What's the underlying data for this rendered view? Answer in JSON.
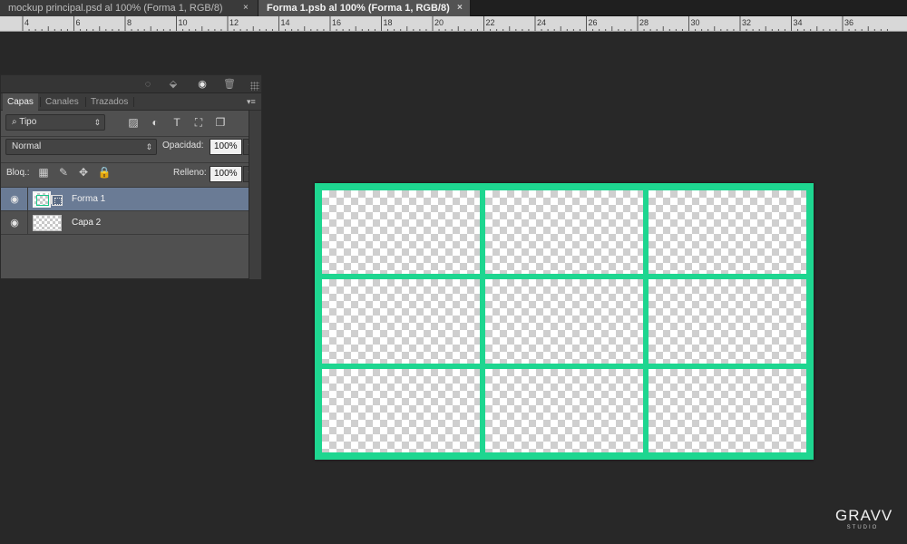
{
  "tabs": [
    {
      "title": "mockup principal.psd al 100% (Forma 1, RGB/8)",
      "close": "×",
      "active": false
    },
    {
      "title": "Forma 1.psb al 100% (Forma 1, RGB/8)",
      "close": "×",
      "active": true
    }
  ],
  "ruler": {
    "labels": [
      "4",
      "6",
      "8",
      "10",
      "12",
      "14",
      "16",
      "18",
      "20",
      "22",
      "24",
      "26",
      "28",
      "30",
      "32",
      "34",
      "36"
    ]
  },
  "panel": {
    "top_icons": [
      "marquee-icon",
      "fill-icon",
      "eye-icon",
      "trash-icon"
    ],
    "tabs": [
      "Capas",
      "Canales",
      "Trazados"
    ],
    "menu_glyph": "▾≡",
    "filter": {
      "label": "Tipo",
      "icon": "search-icon"
    },
    "filter_icons": [
      "image-filter-icon",
      "adjustment-filter-icon",
      "type-filter-icon",
      "shape-filter-icon",
      "smart-object-filter-icon"
    ],
    "blend_mode": "Normal",
    "opacity_label": "Opacidad:",
    "opacity_value": "100%",
    "lock_label": "Bloq.:",
    "lock_icons": [
      "lock-transparency-icon",
      "lock-brush-icon",
      "lock-move-icon",
      "lock-all-icon"
    ],
    "fill_label": "Relleno:",
    "fill_value": "100%",
    "layers": [
      {
        "name": "Forma 1",
        "selected": true,
        "visible": true,
        "kind": "shape"
      },
      {
        "name": "Capa 2",
        "selected": false,
        "visible": true,
        "kind": "pixel"
      }
    ]
  },
  "canvas": {
    "grid_rows": 3,
    "grid_cols": 3,
    "frame_color": "#1ed690"
  },
  "logo": {
    "main": "GRAVV",
    "sub": "STUDIO"
  }
}
